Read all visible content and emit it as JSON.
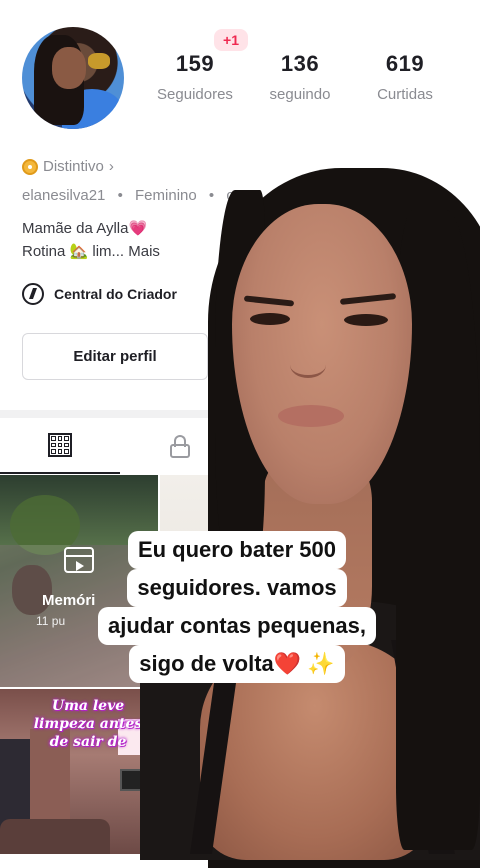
{
  "profile": {
    "notification": "+1",
    "stats": [
      {
        "value": "159",
        "label": "Seguidores"
      },
      {
        "value": "136",
        "label": "seguindo"
      },
      {
        "value": "619",
        "label": "Curtidas"
      }
    ],
    "badge_label": "Distintivo",
    "badge_chevron": "›",
    "username": "elanesilva21",
    "gender": "Feminino",
    "extra_meta": "canc",
    "bio_line1": "Mamãe da Aylla",
    "bio_line1_emoji": "💗",
    "bio_line2_start": "Rotina",
    "bio_line2_emoji": "🏡",
    "bio_line2_rest": " lim...",
    "bio_more": "Mais",
    "creator_center": "Central do Criador",
    "edit_profile": "Editar perfil"
  },
  "tabs": {
    "grid": "grid-icon",
    "private": "lock-icon"
  },
  "videos": {
    "memories_title": "Memóri",
    "memories_sub": "11 pu",
    "tile3_text": "Uma leve limpeza antes de sair de"
  },
  "caption": {
    "line1": "Eu quero bater 500",
    "line2": "seguidores. vamos",
    "line3": "ajudar contas pequenas,",
    "line4": "sigo de volta",
    "heart": "❤️",
    "sparkles": "✨"
  },
  "colors": {
    "accent_red": "#ef2950",
    "badge_gold": "#f4b73b",
    "text_primary": "#161823",
    "text_secondary": "#8a8b91"
  }
}
